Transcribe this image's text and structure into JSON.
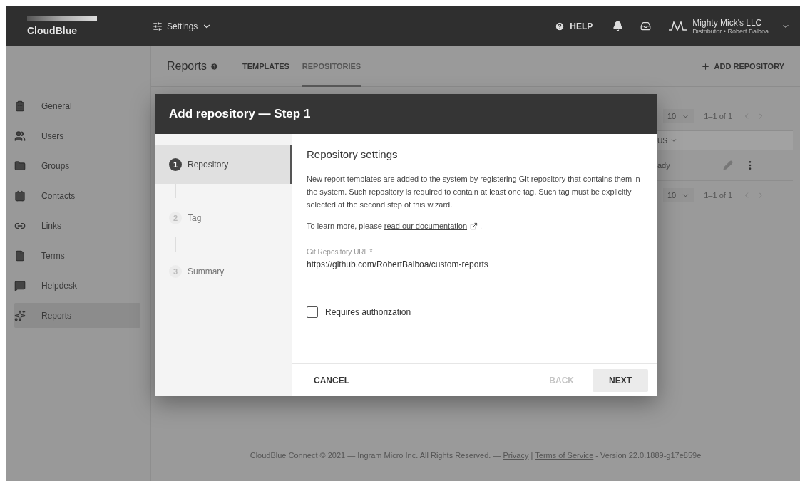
{
  "top_bar": {
    "logo": "CloudBlue",
    "menu": "Settings",
    "help": "HELP",
    "account": {
      "name": "Mighty Mick's LLC",
      "role": "Distributor • Robert Balboa"
    }
  },
  "sidebar": {
    "items": [
      {
        "label": "General",
        "selected": false
      },
      {
        "label": "Users",
        "selected": false
      },
      {
        "label": "Groups",
        "selected": false
      },
      {
        "label": "Contacts",
        "selected": false
      },
      {
        "label": "Links",
        "selected": false
      },
      {
        "label": "Terms",
        "selected": false
      },
      {
        "label": "Helpdesk",
        "selected": false
      },
      {
        "label": "Reports",
        "selected": true
      }
    ]
  },
  "page_header": {
    "title": "Reports",
    "tabs": [
      {
        "label": "TEMPLATES",
        "selected": false
      },
      {
        "label": "REPOSITORIES",
        "selected": true
      }
    ],
    "add_button": "ADD REPOSITORY"
  },
  "table": {
    "top_pagination": {
      "page_size": "10",
      "range": "1–1 of 1"
    },
    "column_header": "US",
    "row_status": "ady",
    "bottom_pagination": {
      "page_size": "10",
      "range": "1–1 of 1"
    }
  },
  "footer": {
    "text": "CloudBlue Connect © 2021 — Ingram Micro Inc. All Rights Reserved. —",
    "links": [
      "Privacy",
      "Terms of Service"
    ],
    "separator": "|",
    "version": "- Version 22.0.1889-g17e859e"
  },
  "dialog": {
    "title": "Add repository — Step 1",
    "steps": [
      {
        "number": "1",
        "label": "Repository",
        "selected": true
      },
      {
        "number": "2",
        "label": "Tag",
        "selected": false
      },
      {
        "number": "3",
        "label": "Summary",
        "selected": false
      }
    ],
    "heading": "Repository settings",
    "description": "New report templates are added to the system by registering Git repository that contains them in the system. Such repository is required to contain at least one tag. Such tag must be explicitly selected at the second step of this wizard.",
    "learn_more": {
      "text": "To learn more, please",
      "link": "read our documentation",
      "end": "."
    },
    "url_field": {
      "label": "Git Repository URL *",
      "value": "https://github.com/RobertBalboa/custom-reports"
    },
    "requires_authorization": {
      "label": "Requires authorization",
      "checked": false
    },
    "buttons": [
      {
        "label": "CANCEL",
        "kind": "text",
        "disabled": false
      },
      {
        "label": "BACK",
        "kind": "text",
        "disabled": true
      },
      {
        "label": "NEXT",
        "kind": "contained",
        "disabled": false
      }
    ]
  }
}
